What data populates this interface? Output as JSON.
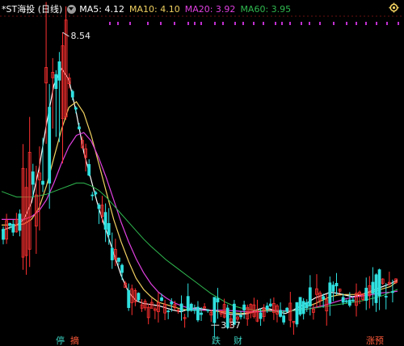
{
  "header": {
    "title": "*ST海投 (日线)",
    "ma5_label": "MA5: 4.12",
    "ma10_label": "MA10: 4.10",
    "ma20_label": "MA20: 3.92",
    "ma60_label": "MA60: 3.95",
    "colors": {
      "title": "#ffffff",
      "ma5": "#ffffff",
      "ma10": "#f0d060",
      "ma20": "#e040e0",
      "ma60": "#2fb84f"
    }
  },
  "markers": {
    "high_label": "8.54",
    "low_label": "3.37"
  },
  "signals": [
    {
      "text": "停",
      "color": "#3ad0c0"
    },
    {
      "text": "摘",
      "color": "#ff5a3a"
    },
    {
      "text": "跌",
      "color": "#3ad0c0"
    },
    {
      "text": "财",
      "color": "#3ad0c0"
    },
    {
      "text": "涨预",
      "color": "#ff5a3a"
    }
  ],
  "chart_data": {
    "type": "candlestick",
    "ylim": [
      3.2,
      8.8
    ],
    "high": 8.54,
    "low": 3.37,
    "ma": {
      "MA5": [
        5.0,
        5.05,
        5.1,
        5.2,
        5.5,
        6.1,
        6.9,
        7.6,
        7.9,
        7.7,
        7.1,
        6.4,
        5.9,
        5.4,
        5.0,
        4.6,
        4.2,
        3.9,
        3.75,
        3.7,
        3.68,
        3.66,
        3.62,
        3.58,
        3.55,
        3.6,
        3.62,
        3.6,
        3.58,
        3.56,
        3.52,
        3.5,
        3.5,
        3.52,
        3.58,
        3.62,
        3.6,
        3.55,
        3.52,
        3.58,
        3.65,
        3.72,
        3.8,
        3.85,
        3.9,
        3.88,
        3.85,
        3.82,
        3.85,
        3.9,
        3.95,
        4.0,
        4.05,
        4.12
      ],
      "MA10": [
        5.1,
        5.1,
        5.1,
        5.12,
        5.2,
        5.4,
        5.8,
        6.3,
        6.8,
        7.2,
        7.3,
        7.1,
        6.7,
        6.2,
        5.7,
        5.2,
        4.8,
        4.45,
        4.15,
        3.95,
        3.82,
        3.72,
        3.68,
        3.64,
        3.6,
        3.58,
        3.58,
        3.58,
        3.57,
        3.56,
        3.55,
        3.53,
        3.52,
        3.53,
        3.55,
        3.58,
        3.58,
        3.57,
        3.56,
        3.57,
        3.6,
        3.65,
        3.7,
        3.76,
        3.82,
        3.85,
        3.86,
        3.86,
        3.86,
        3.88,
        3.92,
        3.96,
        4.0,
        4.1
      ],
      "MA20": [
        5.2,
        5.2,
        5.2,
        5.2,
        5.25,
        5.35,
        5.55,
        5.85,
        6.2,
        6.5,
        6.7,
        6.75,
        6.6,
        6.3,
        5.95,
        5.55,
        5.15,
        4.8,
        4.5,
        4.25,
        4.05,
        3.9,
        3.8,
        3.72,
        3.66,
        3.62,
        3.6,
        3.58,
        3.58,
        3.58,
        3.58,
        3.57,
        3.56,
        3.55,
        3.55,
        3.56,
        3.57,
        3.57,
        3.57,
        3.57,
        3.58,
        3.6,
        3.63,
        3.66,
        3.7,
        3.74,
        3.78,
        3.81,
        3.83,
        3.85,
        3.87,
        3.89,
        3.9,
        3.92
      ],
      "MA60": [
        5.7,
        5.65,
        5.6,
        5.6,
        5.6,
        5.62,
        5.65,
        5.7,
        5.75,
        5.8,
        5.85,
        5.85,
        5.8,
        5.72,
        5.6,
        5.45,
        5.3,
        5.15,
        5.0,
        4.85,
        4.72,
        4.6,
        4.48,
        4.38,
        4.28,
        4.18,
        4.08,
        3.98,
        3.88,
        3.8,
        3.72,
        3.66,
        3.62,
        3.6,
        3.58,
        3.57,
        3.56,
        3.56,
        3.56,
        3.57,
        3.58,
        3.6,
        3.62,
        3.64,
        3.66,
        3.68,
        3.7,
        3.72,
        3.74,
        3.77,
        3.8,
        3.84,
        3.9,
        3.95
      ]
    }
  }
}
